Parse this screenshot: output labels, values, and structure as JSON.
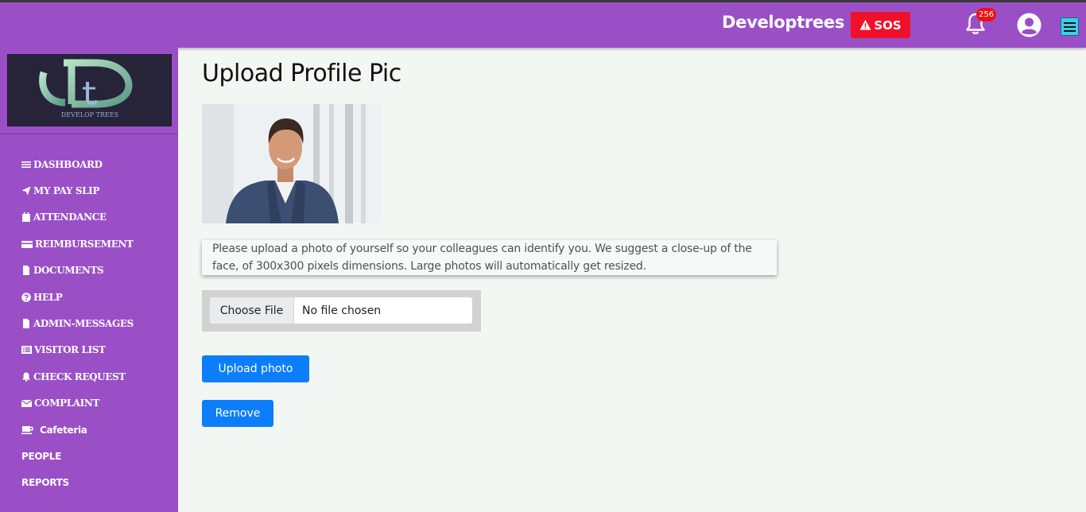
{
  "header": {
    "brand": "Developtrees",
    "sos_label": "SOS",
    "notification_count": "256"
  },
  "sidebar": {
    "logo_text": "DEVELOP TREES",
    "items": [
      {
        "label": "DASHBOARD",
        "icon": "bars-icon"
      },
      {
        "label": "MY PAY SLIP",
        "icon": "paper-plane-icon"
      },
      {
        "label": "ATTENDANCE",
        "icon": "calendar-icon"
      },
      {
        "label": "REIMBURSEMENT",
        "icon": "credit-card-icon"
      },
      {
        "label": "DOCUMENTS",
        "icon": "file-icon"
      },
      {
        "label": "HELP",
        "icon": "question-circle-icon"
      },
      {
        "label": "ADMIN-MESSAGES",
        "icon": "file-icon"
      },
      {
        "label": "VISITOR LIST",
        "icon": "list-icon"
      },
      {
        "label": "CHECK REQUEST",
        "icon": "bell-icon"
      },
      {
        "label": "COMPLAINT",
        "icon": "envelope-icon"
      },
      {
        "label": "Cafeteria",
        "icon": "coffee-icon"
      },
      {
        "label": "PEOPLE",
        "icon": ""
      },
      {
        "label": "REPORTS",
        "icon": ""
      }
    ]
  },
  "main": {
    "title": "Upload Profile Pic",
    "info_text": "Please upload a photo of yourself so your colleagues can identify you. We suggest a close-up of the face, of 300x300 pixels dimensions. Large photos will automatically get resized.",
    "file_button": "Choose File",
    "file_status": "No file chosen",
    "upload_label": "Upload photo",
    "remove_label": "Remove"
  },
  "colors": {
    "sidebar": "#9a4fc6",
    "sos": "#f0102a",
    "primary_button": "#0d7efb",
    "background": "#f3f7f4"
  }
}
